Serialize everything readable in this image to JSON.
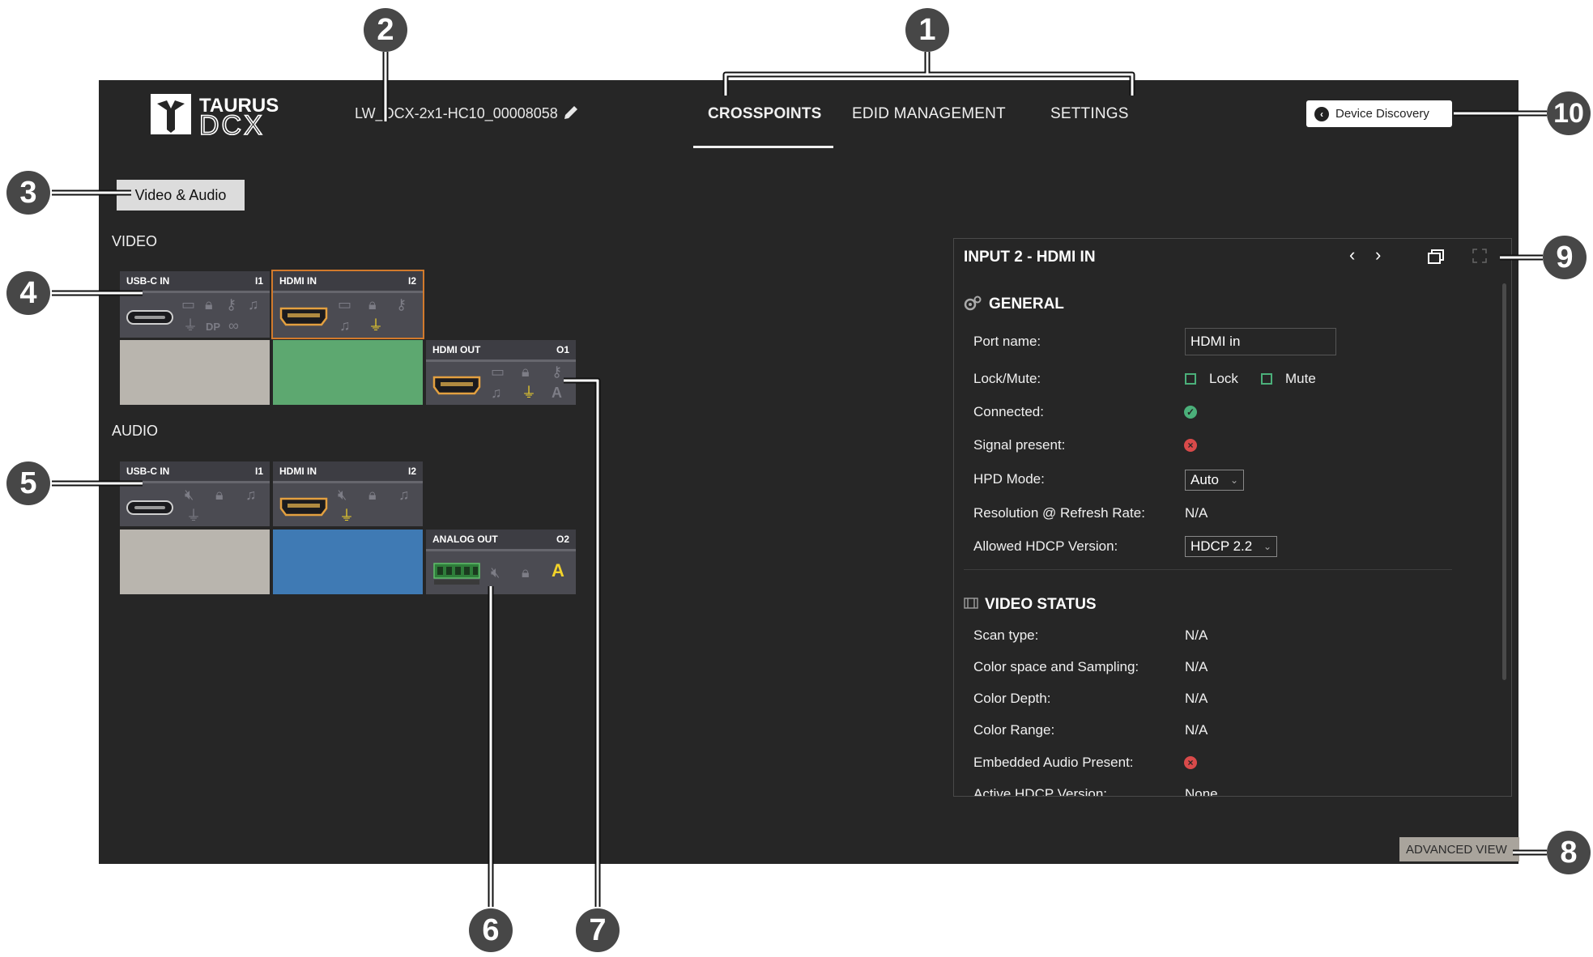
{
  "header": {
    "brand_line1": "TAURUS",
    "brand_line2": "DCX",
    "device_name": "LW_DCX-2x1-HC10_00008058",
    "tabs": [
      "CROSSPOINTS",
      "EDID MANAGEMENT",
      "SETTINGS"
    ],
    "active_tab": "CROSSPOINTS",
    "device_discovery_label": "Device Discovery"
  },
  "left": {
    "filter_button": "Video & Audio",
    "video_label": "VIDEO",
    "audio_label": "AUDIO",
    "video_ports": [
      {
        "name": "USB-C IN",
        "id": "I1"
      },
      {
        "name": "HDMI IN",
        "id": "I2"
      },
      {
        "name": "HDMI OUT",
        "id": "O1"
      }
    ],
    "audio_ports": [
      {
        "name": "USB-C IN",
        "id": "I1"
      },
      {
        "name": "HDMI IN",
        "id": "I2"
      },
      {
        "name": "ANALOG OUT",
        "id": "O2"
      }
    ],
    "dp_text": "DP",
    "audio_a": "A"
  },
  "panel": {
    "title": "INPUT 2 - HDMI IN",
    "general_title": "GENERAL",
    "port_name_label": "Port name:",
    "port_name_value": "HDMI in",
    "lock_mute_label": "Lock/Mute:",
    "lock_label": "Lock",
    "mute_label": "Mute",
    "connected_label": "Connected:",
    "signal_label": "Signal present:",
    "hpd_label": "HPD Mode:",
    "hpd_value": "Auto",
    "resolution_label": "Resolution @ Refresh Rate:",
    "resolution_value": "N/A",
    "hdcp_label": "Allowed HDCP Version:",
    "hdcp_value": "HDCP 2.2",
    "video_status_title": "VIDEO STATUS",
    "scan_label": "Scan type:",
    "scan_value": "N/A",
    "colorspace_label": "Color space and Sampling:",
    "colorspace_value": "N/A",
    "depth_label": "Color Depth:",
    "depth_value": "N/A",
    "range_label": "Color Range:",
    "range_value": "N/A",
    "embedded_label": "Embedded Audio Present:",
    "active_hdcp_label": "Active HDCP Version:",
    "active_hdcp_value": "None"
  },
  "advanced_view_label": "ADVANCED VIEW",
  "callouts": [
    "1",
    "2",
    "3",
    "4",
    "5",
    "6",
    "7",
    "8",
    "9",
    "10"
  ],
  "colors": {
    "background": "#262626",
    "selected_border": "#d27a2c",
    "green_tile": "#5da870",
    "blue_tile": "#3f7ab4",
    "grey_tile": "#b9b5ae",
    "ok": "#4bb07a",
    "error": "#d94a4a",
    "plug_yellow": "#f2d32a"
  }
}
